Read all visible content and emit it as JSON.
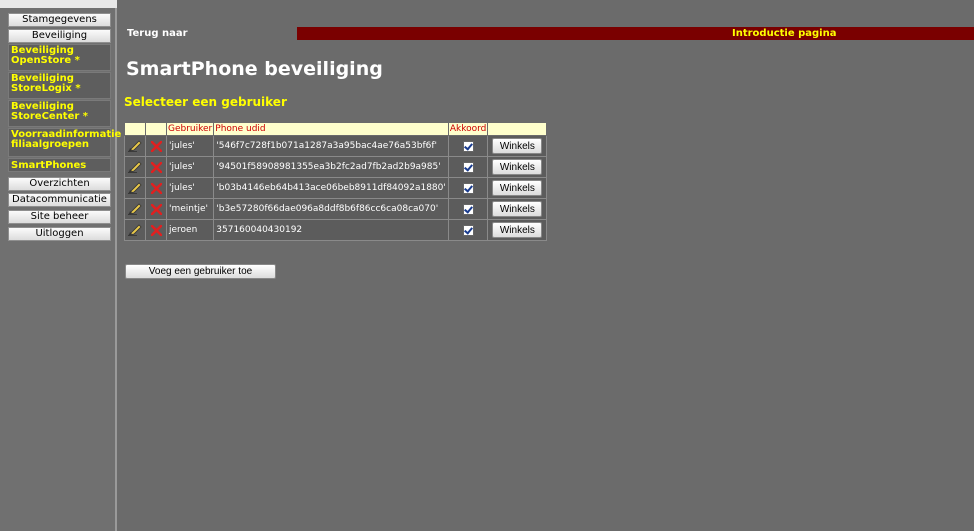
{
  "sidebar": {
    "items": [
      {
        "label": "Stamgegevens"
      },
      {
        "label": "Beveiliging"
      },
      {
        "label": "Beveiliging OpenStore *"
      },
      {
        "label": "Beveiliging StoreLogix *"
      },
      {
        "label": "Beveiliging StoreCenter *"
      },
      {
        "label": "Voorraadinformatie filiaalgroepen"
      },
      {
        "label": "SmartPhones"
      },
      {
        "label": "Overzichten"
      },
      {
        "label": "Datacommunicatie"
      },
      {
        "label": "Site beheer"
      },
      {
        "label": "Uitloggen"
      }
    ]
  },
  "header": {
    "back_label": "Terug naar",
    "intro_label": "Introductie pagina"
  },
  "main": {
    "title": "SmartPhone beveiliging",
    "subtitle": "Selecteer een gebruiker",
    "table": {
      "columns": [
        "Gebruiker",
        "Phone udid",
        "Akkoord"
      ],
      "rows": [
        {
          "user": "'jules'",
          "udid": "'546f7c728f1b071a1287a3a95bac4ae76a53bf6f'",
          "akkoord": true,
          "button": "Winkels"
        },
        {
          "user": "'jules'",
          "udid": "'94501f58908981355ea3b2fc2ad7fb2ad2b9a985'",
          "akkoord": true,
          "button": "Winkels"
        },
        {
          "user": "'jules'",
          "udid": "'b03b4146eb64b413ace06beb8911df84092a1880'",
          "akkoord": true,
          "button": "Winkels"
        },
        {
          "user": "'meintje'",
          "udid": "'b3e57280f66dae096a8ddf8b6f86cc6ca08ca070'",
          "akkoord": true,
          "button": "Winkels"
        },
        {
          "user": "jeroen",
          "udid": "357160040430192",
          "akkoord": true,
          "button": "Winkels"
        }
      ]
    },
    "add_user_label": "Voeg een gebruiker toe"
  }
}
